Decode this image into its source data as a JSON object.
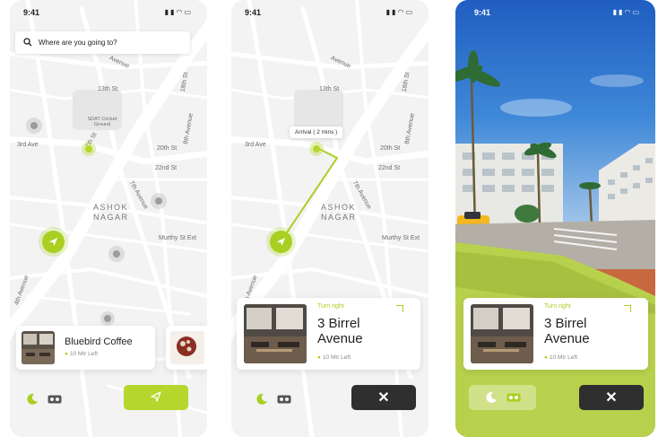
{
  "colors": {
    "accent": "#b5d62c",
    "dark_button": "#2f2f2f",
    "map_bg": "#f3f3f3",
    "road": "#ffffff"
  },
  "status": {
    "time": "9:41",
    "icons": [
      "signal-icon",
      "wifi-icon",
      "battery-icon"
    ]
  },
  "search": {
    "placeholder": "Where are you going to?"
  },
  "map_labels": {
    "third_avenue": "3rd Ave",
    "thirteenth_st": "13th St",
    "eighteenth_st": "18th St",
    "twentieth_st": "20th St",
    "twentysecond_st": "22nd St",
    "seventh_avenue": "7th Avenue",
    "eighth_avenue": "8th Avenue",
    "murthy_st_ext": "Murthy St Ext",
    "fourth_avenue": "4th Avenue",
    "sdat_ground": "SDAT Cricket Ground",
    "avenue_top": "Avenue",
    "area_line1": "ASHOK",
    "area_line2": "NAGAR"
  },
  "screen1": {
    "place_card": {
      "title": "Bluebird Coffee",
      "distance": "10 Mtr Left"
    }
  },
  "screen2": {
    "tooltip": "Arrival ( 2 mins )",
    "direction": {
      "instruction": "Turn right",
      "street_line1": "3 Birrel",
      "street_line2": "Avenue",
      "distance": "10 Mtr Left"
    }
  },
  "screen3": {
    "direction": {
      "instruction": "Turn right",
      "street_line1": "3 Birrel",
      "street_line2": "Avenue",
      "distance": "10 Mtr Left"
    }
  }
}
